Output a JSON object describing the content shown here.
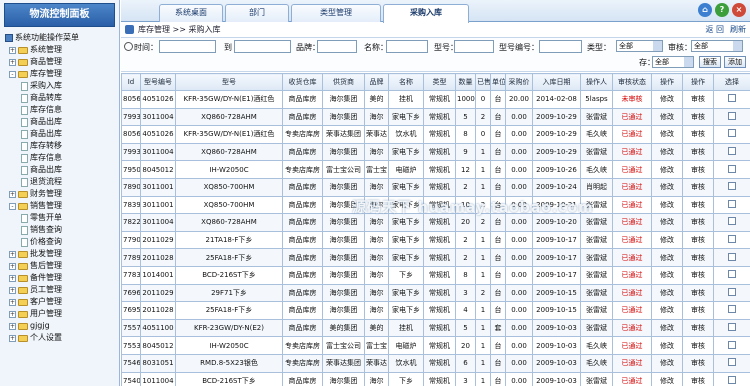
{
  "sidebar": {
    "title": "物流控制面板",
    "root": "系统功能操作菜单",
    "items": [
      {
        "label": "系统管理",
        "type": "group",
        "sign": "+"
      },
      {
        "label": "商品管理",
        "type": "group",
        "sign": "+"
      },
      {
        "label": "库存管理",
        "type": "group",
        "sign": "-"
      },
      {
        "label": "采购入库",
        "type": "child"
      },
      {
        "label": "商品转库",
        "type": "child"
      },
      {
        "label": "库存信息",
        "type": "child"
      },
      {
        "label": "商品出库",
        "type": "child"
      },
      {
        "label": "商品出库",
        "type": "child"
      },
      {
        "label": "库存转移",
        "type": "child"
      },
      {
        "label": "库存信息",
        "type": "child"
      },
      {
        "label": "商品出库",
        "type": "child"
      },
      {
        "label": "退货流程",
        "type": "child"
      },
      {
        "label": "财务管理",
        "type": "group",
        "sign": "+"
      },
      {
        "label": "销售管理",
        "type": "group",
        "sign": "-"
      },
      {
        "label": "零售开单",
        "type": "child"
      },
      {
        "label": "销售查询",
        "type": "child"
      },
      {
        "label": "价格查询",
        "type": "child"
      },
      {
        "label": "批发管理",
        "type": "group",
        "sign": "+"
      },
      {
        "label": "售后管理",
        "type": "group",
        "sign": "+"
      },
      {
        "label": "备件管理",
        "type": "group",
        "sign": "+"
      },
      {
        "label": "员工管理",
        "type": "group",
        "sign": "+"
      },
      {
        "label": "客户管理",
        "type": "group",
        "sign": "+"
      },
      {
        "label": "用户管理",
        "type": "group",
        "sign": "+"
      },
      {
        "label": "gjgjg",
        "type": "group",
        "sign": "+"
      },
      {
        "label": "个人设置",
        "type": "group",
        "sign": "+"
      }
    ]
  },
  "tabs": [
    "系统桌面",
    "部门",
    "类型管理",
    "采购入库"
  ],
  "top_icons": [
    {
      "name": "home-icon",
      "glyph": "⌂",
      "color": "#3c7fd0"
    },
    {
      "name": "help-icon",
      "glyph": "?",
      "color": "#3c9f3c"
    },
    {
      "name": "exit-icon",
      "glyph": "×",
      "color": "#d04a3a"
    }
  ],
  "path": {
    "text": "库存管理 >> 采购入库",
    "back": "返 回",
    "refresh": "刷新"
  },
  "filter": {
    "time_label": "时间：",
    "to_label": "到",
    "brand_label": "品牌：",
    "name_label": "名称：",
    "model_label": "型号：",
    "buy_code_label": "型号编号：",
    "category_label": "类型：",
    "category_value": "全部",
    "audit_label": "审核：",
    "audit_value": "全部",
    "status_label": "存：",
    "status_value": "全部",
    "search_btn": "搜索",
    "add_btn": "添加"
  },
  "table": {
    "headers": [
      "Id",
      "型号编号",
      "型号",
      "收货仓库",
      "供货商",
      "品牌",
      "名称",
      "类型",
      "数量",
      "已售",
      "单位",
      "采购价",
      "入库日期",
      "操作人",
      "审核状态",
      "操作",
      "操作",
      "选择"
    ],
    "rows": [
      [
        "8056",
        "4051026",
        "KFR-35GW/DY-N(E1)酒红色",
        "商品库房",
        "海尔集团",
        "美的",
        "挂机",
        "常规机",
        "1000",
        "0",
        "台",
        "20.00",
        "2014-02-08",
        "5lasps",
        "未审核",
        "修改",
        "审核",
        ""
      ],
      [
        "7993",
        "3011004",
        "XQ860-728AHM",
        "商品库房",
        "海尔集团",
        "海尔",
        "家电下乡",
        "常规机",
        "5",
        "2",
        "台",
        "0.00",
        "2009-10-29",
        "张雷斌",
        "已通过",
        "修改",
        "审核",
        ""
      ],
      [
        "8056",
        "4051026",
        "KFR-35GW/DY-N(E1)酒红色",
        "专卖店库房",
        "荣事达集团",
        "荣事达",
        "饮水机",
        "常规机",
        "8",
        "0",
        "台",
        "0.00",
        "2009-10-29",
        "毛久峡",
        "已通过",
        "修改",
        "审核",
        ""
      ],
      [
        "7993",
        "3011004",
        "XQ860-728AHM",
        "商品库房",
        "海尔集团",
        "海尔",
        "家电下乡",
        "常规机",
        "9",
        "1",
        "台",
        "0.00",
        "2009-10-29",
        "张雷斌",
        "已通过",
        "修改",
        "审核",
        ""
      ],
      [
        "7950",
        "8045012",
        "IH-W2050C",
        "专卖店库房",
        "富士宝公司",
        "富士宝",
        "电磁炉",
        "常规机",
        "12",
        "1",
        "台",
        "0.00",
        "2009-10-26",
        "毛久峡",
        "已通过",
        "修改",
        "审核",
        ""
      ],
      [
        "7890",
        "3011001",
        "XQ850-700HM",
        "商品库房",
        "海尔集团",
        "海尔",
        "家电下乡",
        "常规机",
        "2",
        "1",
        "台",
        "0.00",
        "2009-10-24",
        "肖明起",
        "已通过",
        "修改",
        "审核",
        ""
      ],
      [
        "7839",
        "3011001",
        "XQ850-700HM",
        "商品库房",
        "海尔集团",
        "海尔",
        "家电下乡",
        "常规机",
        "10",
        "2",
        "台",
        "0.00",
        "2009-10-21",
        "张雷斌",
        "已通过",
        "修改",
        "审核",
        ""
      ],
      [
        "7822",
        "3011004",
        "XQ860-728AHM",
        "商品库房",
        "海尔集团",
        "海尔",
        "家电下乡",
        "常规机",
        "20",
        "2",
        "台",
        "0.00",
        "2009-10-20",
        "张雷斌",
        "已通过",
        "修改",
        "审核",
        ""
      ],
      [
        "7790",
        "2011029",
        "21TA18-F下乡",
        "商品库房",
        "海尔集团",
        "海尔",
        "家电下乡",
        "常规机",
        "2",
        "1",
        "台",
        "0.00",
        "2009-10-17",
        "张雷斌",
        "已通过",
        "修改",
        "审核",
        ""
      ],
      [
        "7789",
        "2011028",
        "25FA18-F下乡",
        "商品库房",
        "海尔集团",
        "海尔",
        "家电下乡",
        "常规机",
        "2",
        "1",
        "台",
        "0.00",
        "2009-10-17",
        "张雷斌",
        "已通过",
        "修改",
        "审核",
        ""
      ],
      [
        "7783",
        "1014001",
        "BCD-216ST下乡",
        "商品库房",
        "海尔集团",
        "海尔",
        "下乡",
        "常规机",
        "8",
        "1",
        "台",
        "0.00",
        "2009-10-17",
        "张雷斌",
        "已通过",
        "修改",
        "审核",
        ""
      ],
      [
        "7696",
        "2011029",
        "29F71下乡",
        "商品库房",
        "海尔集团",
        "海尔",
        "家电下乡",
        "常规机",
        "3",
        "2",
        "台",
        "0.00",
        "2009-10-15",
        "张雷斌",
        "已通过",
        "修改",
        "审核",
        ""
      ],
      [
        "7695",
        "2011028",
        "25FA18-F下乡",
        "商品库房",
        "海尔集团",
        "海尔",
        "家电下乡",
        "常规机",
        "4",
        "1",
        "台",
        "0.00",
        "2009-10-15",
        "张雷斌",
        "已通过",
        "修改",
        "审核",
        ""
      ],
      [
        "7557",
        "4051100",
        "KFR-23GW/DY-N(E2)",
        "商品库房",
        "美的集团",
        "美的",
        "挂机",
        "常规机",
        "5",
        "1",
        "套",
        "0.00",
        "2009-10-03",
        "张雷斌",
        "已通过",
        "修改",
        "审核",
        ""
      ],
      [
        "7553",
        "8045012",
        "IH-W2050C",
        "专卖店库房",
        "富士宝公司",
        "富士宝",
        "电磁炉",
        "常规机",
        "20",
        "1",
        "台",
        "0.00",
        "2009-10-03",
        "毛久峡",
        "已通过",
        "修改",
        "审核",
        ""
      ],
      [
        "7546",
        "8031051",
        "RMD.8-5X23银色",
        "专卖店库房",
        "荣事达集团",
        "荣事达",
        "饮水机",
        "常规机",
        "6",
        "1",
        "台",
        "0.00",
        "2009-10-03",
        "毛久峡",
        "已通过",
        "修改",
        "审核",
        ""
      ],
      [
        "7540",
        "1011004",
        "BCD-216ST下乡",
        "商品库房",
        "海尔集团",
        "海尔",
        "下乡",
        "常规机",
        "3",
        "1",
        "台",
        "0.00",
        "2009-10-03",
        "张雷斌",
        "已通过",
        "修改",
        "审核",
        ""
      ]
    ]
  },
  "watermark": "源码天下 huamay.taobao.com"
}
